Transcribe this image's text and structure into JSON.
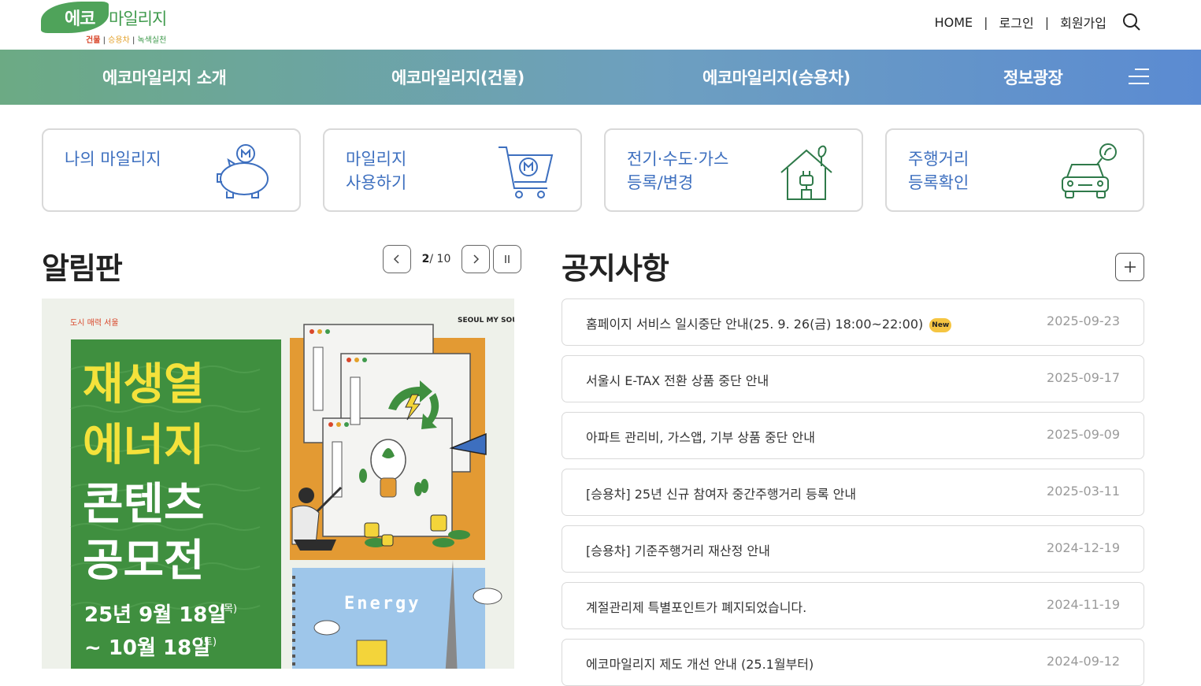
{
  "header": {
    "logo": {
      "eco": "에코",
      "mileage": "마일리지",
      "sub1": "건물",
      "sub2": "승용차",
      "sub3": "녹색실천"
    },
    "util": [
      "HOME",
      "로그인",
      "회원가입"
    ]
  },
  "gnb": {
    "items": [
      "에코마일리지 소개",
      "에코마일리지(건물)",
      "에코마일리지(승용차)",
      "정보광장"
    ]
  },
  "quick": [
    {
      "label": "나의 마일리지",
      "icon": "piggy-bank-icon"
    },
    {
      "label": "마일리지\n사용하기",
      "icon": "cart-icon"
    },
    {
      "label": "전기·수도·가스\n등록/변경",
      "icon": "house-plug-icon"
    },
    {
      "label": "주행거리\n등록확인",
      "icon": "car-icon"
    }
  ],
  "board": {
    "title": "알림판",
    "current": "2",
    "total": "/ 10",
    "banner": {
      "top_left": "도시 매력 서울",
      "top_right": "SEOUL MY SOUL",
      "line1": "재생열",
      "line2": "에너지",
      "line3": "콘텐츠",
      "line4": "공모전",
      "date1": "25년 9월 18일",
      "day1": "(목)",
      "date2": "~ 10월 18일",
      "day2": "(토)",
      "energy": "Energy"
    }
  },
  "notices": {
    "title": "공지사항",
    "new_label": "New",
    "items": [
      {
        "title": "홈페이지 서비스 일시중단 안내(25. 9. 26(금) 18:00~22:00)",
        "date": "2025-09-23",
        "is_new": true
      },
      {
        "title": "서울시 E-TAX 전환 상품 중단 안내",
        "date": "2025-09-17"
      },
      {
        "title": "아파트 관리비, 가스앱, 기부 상품 중단 안내",
        "date": "2025-09-09"
      },
      {
        "title": "[승용차] 25년 신규 참여자 중간주행거리 등록 안내",
        "date": "2025-03-11"
      },
      {
        "title": "[승용차] 기준주행거리 재산정 안내",
        "date": "2024-12-19"
      },
      {
        "title": "계절관리제 특별포인트가 폐지되었습니다.",
        "date": "2024-11-19"
      },
      {
        "title": "에코마일리지 제도 개선 안내 (25.1월부터)",
        "date": "2024-09-12"
      }
    ]
  },
  "colors": {
    "accent_green": "#4fa35a",
    "accent_blue": "#3d6fbf",
    "badge": "#f5c542"
  }
}
